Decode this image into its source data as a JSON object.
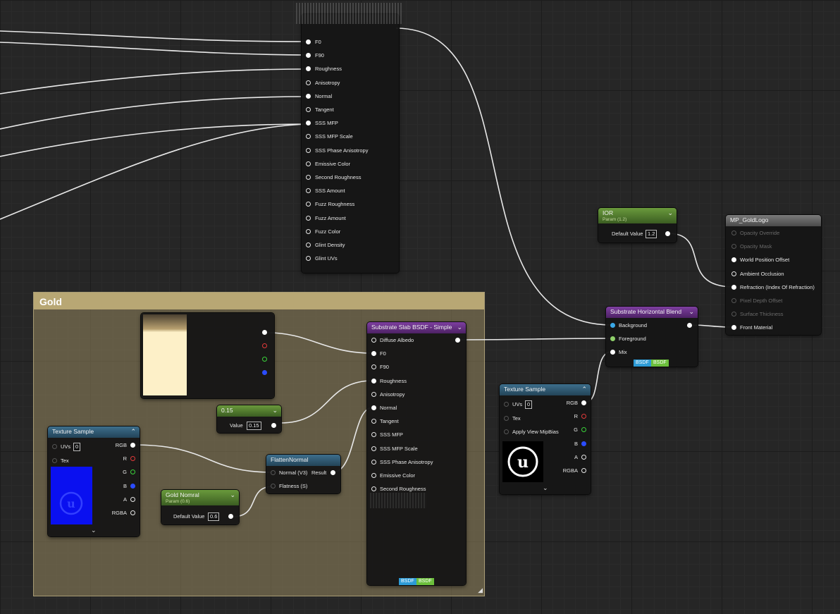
{
  "comment": {
    "title": "Gold"
  },
  "top_node": {
    "pins": [
      "F0",
      "F90",
      "Roughness",
      "Anisotropy",
      "Normal",
      "Tangent",
      "SSS MFP",
      "SSS MFP Scale",
      "SSS Phase Anisotropy",
      "Emissive Color",
      "Second Roughness",
      "SSS Amount",
      "Fuzz Roughness",
      "Fuzz Amount",
      "Fuzz Color",
      "Glint Density",
      "Glint UVs"
    ]
  },
  "ior_node": {
    "title": "IOR",
    "subtitle": "Param (1.2)",
    "default_label": "Default Value",
    "value": "1.2"
  },
  "mp_node": {
    "title": "MP_GoldLogo",
    "pins": [
      "Opacity Override",
      "Opacity Mask",
      "World Position Offset",
      "Ambient Occlusion",
      "Refraction (Index Of Refraction)",
      "Pixel Depth Offset",
      "Surface Thickness",
      "Front Material"
    ]
  },
  "blend_node": {
    "title": "Substrate Horizontal Blend",
    "pins": [
      "Background",
      "Foreground",
      "Mix"
    ],
    "tags": [
      "BSDF",
      "BSDF"
    ]
  },
  "slab_node": {
    "title": "Substrate Slab BSDF - Simple",
    "pins": [
      "Diffuse Albedo",
      "F0",
      "F90",
      "Roughness",
      "Anisotropy",
      "Normal",
      "Tangent",
      "SSS MFP",
      "SSS MFP Scale",
      "SSS Phase Anisotropy",
      "Emissive Color",
      "Second Roughness"
    ],
    "tags": [
      "BSDF",
      "BSDF"
    ]
  },
  "const_node": {
    "title": "0.15",
    "value_label": "Value",
    "value": "0.15"
  },
  "flatten_node": {
    "title": "FlattenNormal",
    "pins": [
      "Normal (V3)",
      "Flatness (S)"
    ],
    "result": "Result"
  },
  "gold_normal_node": {
    "title": "Gold Nomral",
    "subtitle": "Param (0.6)",
    "default_label": "Default Value",
    "value": "0.6"
  },
  "tex_left": {
    "title": "Texture Sample",
    "uvs": "UVs",
    "uvs_val": "0",
    "tex": "Tex",
    "outs": [
      "RGB",
      "R",
      "G",
      "B",
      "A",
      "RGBA"
    ]
  },
  "tex_right": {
    "title": "Texture Sample",
    "uvs": "UVs",
    "uvs_val": "0",
    "tex": "Tex",
    "mip": "Apply View MipBias",
    "outs": [
      "RGB",
      "R",
      "G",
      "B",
      "A",
      "RGBA"
    ]
  },
  "colors": {
    "comment_header": "#b8a774",
    "param_header": "#6a9a3c",
    "substrate_header": "#7d3fa0",
    "texture_header": "#3d6e8c"
  },
  "icons": [
    "unreal-logo-icon",
    "chevron-down-icon"
  ]
}
